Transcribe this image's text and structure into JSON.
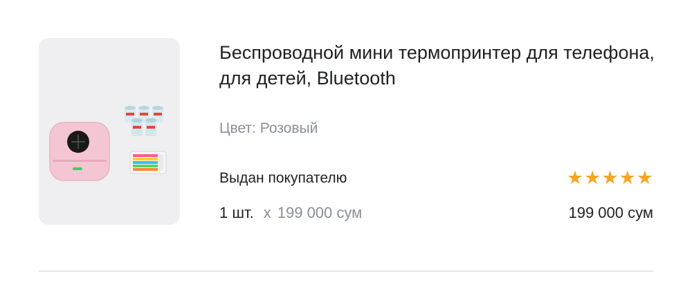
{
  "product": {
    "title": "Беспроводной мини термопринтер для телефона, для детей, Bluetooth",
    "color_label": "Цвет:",
    "color_value": "Розовый",
    "status": "Выдан покупателю",
    "quantity": "1 шт.",
    "times": "x",
    "unit_price": "199 000 сум",
    "total_price": "199 000 сум",
    "rating": 5,
    "rating_max": 5,
    "star_color": "#f5a623",
    "image_icon": "pink-mini-printer-with-paper-rolls-and-markers"
  }
}
